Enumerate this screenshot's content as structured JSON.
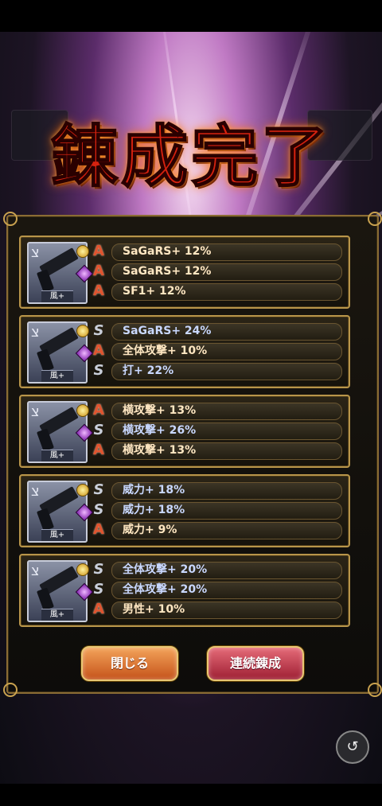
{
  "title": "錬成完了",
  "cards": [
    {
      "element_label": "風+",
      "rows": [
        {
          "rank": "A",
          "text": "SaGaRS+ 12%"
        },
        {
          "rank": "A",
          "text": "SaGaRS+ 12%"
        },
        {
          "rank": "A",
          "text": "SF1+ 12%"
        }
      ]
    },
    {
      "element_label": "風+",
      "rows": [
        {
          "rank": "S",
          "text": "SaGaRS+ 24%"
        },
        {
          "rank": "A",
          "text": "全体攻撃+ 10%"
        },
        {
          "rank": "S",
          "text": "打+ 22%"
        }
      ]
    },
    {
      "element_label": "風+",
      "rows": [
        {
          "rank": "A",
          "text": "横攻撃+ 13%"
        },
        {
          "rank": "S",
          "text": "横攻撃+ 26%"
        },
        {
          "rank": "A",
          "text": "横攻撃+ 13%"
        }
      ]
    },
    {
      "element_label": "風+",
      "rows": [
        {
          "rank": "S",
          "text": "威力+ 18%"
        },
        {
          "rank": "S",
          "text": "威力+ 18%"
        },
        {
          "rank": "A",
          "text": "威力+ 9%"
        }
      ]
    },
    {
      "element_label": "風+",
      "rows": [
        {
          "rank": "S",
          "text": "全体攻撃+ 20%"
        },
        {
          "rank": "S",
          "text": "全体攻撃+ 20%"
        },
        {
          "rank": "A",
          "text": "男性+ 10%"
        }
      ]
    }
  ],
  "buttons": {
    "close_label": "閉じる",
    "continue_label": "連続錬成"
  },
  "rank_glyphs": {
    "A": "A",
    "S": "S"
  },
  "icons": {
    "weapon": "pistol-icon",
    "coin": "gold-coin-icon",
    "gem": "purple-gem-icon",
    "share": "share-icon"
  },
  "colors": {
    "rank_A": "#e0542f",
    "rank_S": "#c9ced9",
    "panel_border": "#b8954a",
    "title": "#d6220f"
  }
}
